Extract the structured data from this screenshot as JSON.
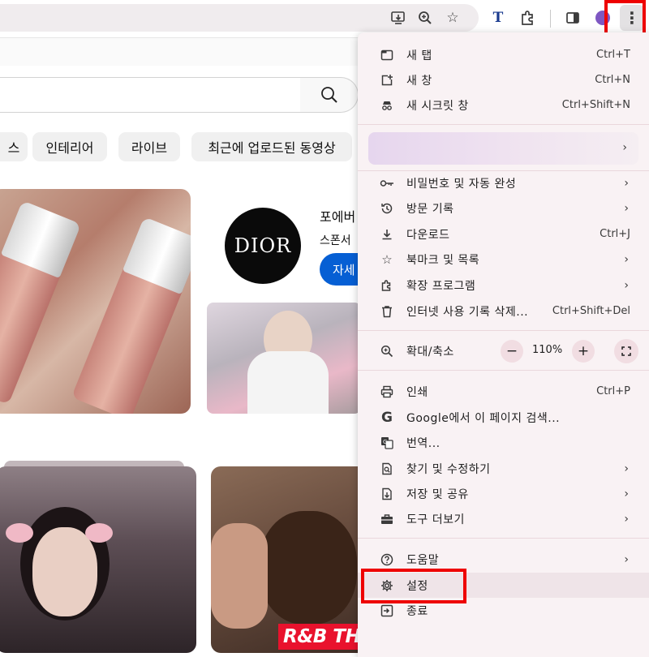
{
  "toolbar": {
    "icons": [
      "install-app-icon",
      "zoom-icon",
      "bookmark-star-icon",
      "translate-extension-icon",
      "extensions-icon",
      "side-panel-icon",
      "profile-avatar",
      "more-menu-icon"
    ],
    "translate_ext_label": "T"
  },
  "search": {
    "icon": "search-icon"
  },
  "chips": [
    "스",
    "인테리어",
    "라이브",
    "최근에 업로드된 동영상"
  ],
  "ad": {
    "brand_logo": "DIOR",
    "title": "포에버",
    "sponsor": "스폰서",
    "cta": "자세"
  },
  "video_overlay": "R&B THROWBACK HITS",
  "menu": {
    "group1": [
      {
        "icon": "new-tab-icon",
        "label": "새 탭",
        "shortcut": "Ctrl+T"
      },
      {
        "icon": "new-window-icon",
        "label": "새 창",
        "shortcut": "Ctrl+N"
      },
      {
        "icon": "incognito-icon",
        "label": "새 시크릿 창",
        "shortcut": "Ctrl+Shift+N"
      }
    ],
    "group2": [
      {
        "icon": "key-icon",
        "label": "비밀번호 및 자동 완성",
        "shortcut": ""
      },
      {
        "icon": "history-icon",
        "label": "방문 기록",
        "shortcut": ""
      },
      {
        "icon": "download-icon",
        "label": "다운로드",
        "shortcut": "Ctrl+J"
      },
      {
        "icon": "star-icon",
        "label": "북마크 및 목록",
        "shortcut": ""
      },
      {
        "icon": "puzzle-icon",
        "label": "확장 프로그램",
        "shortcut": ""
      },
      {
        "icon": "trash-icon",
        "label": "인터넷 사용 기록 삭제...",
        "shortcut": "Ctrl+Shift+Del"
      }
    ],
    "zoom": {
      "label": "확대/축소",
      "value": "110%",
      "minus": "−",
      "plus": "+"
    },
    "group3": [
      {
        "icon": "print-icon",
        "label": "인쇄",
        "shortcut": "Ctrl+P"
      },
      {
        "icon": "google-icon",
        "label": "Google에서 이 페이지 검색...",
        "shortcut": ""
      },
      {
        "icon": "translate-icon",
        "label": "번역...",
        "shortcut": ""
      },
      {
        "icon": "find-edit-icon",
        "label": "찾기 및 수정하기",
        "shortcut": ""
      },
      {
        "icon": "save-share-icon",
        "label": "저장 및 공유",
        "shortcut": ""
      },
      {
        "icon": "toolbox-icon",
        "label": "도구 더보기",
        "shortcut": ""
      }
    ],
    "group4": [
      {
        "icon": "help-icon",
        "label": "도움말",
        "shortcut": ""
      },
      {
        "icon": "settings-gear-icon",
        "label": "설정",
        "shortcut": ""
      },
      {
        "icon": "exit-icon",
        "label": "종료",
        "shortcut": ""
      }
    ]
  },
  "highlights": {
    "color": "#ee0000"
  }
}
